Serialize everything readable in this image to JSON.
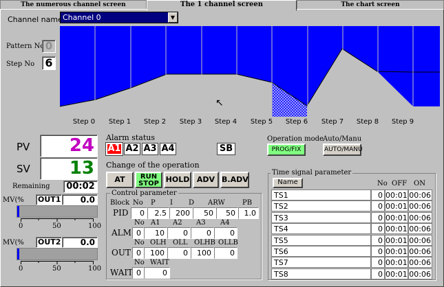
{
  "tabs": [
    {
      "label": "The numerous channel screen"
    },
    {
      "label": "The 1 channel screen"
    },
    {
      "label": "The chart screen"
    }
  ],
  "channel": {
    "label": "Channel name",
    "value": "Channel 0"
  },
  "pattern": {
    "label": "Pattern No",
    "value": "0"
  },
  "step": {
    "label": "Step No",
    "value": "6"
  },
  "steps": [
    "Step 0",
    "Step 1",
    "Step 2",
    "Step 3",
    "Step 4",
    "Step 5",
    "Step 6",
    "Step 7",
    "Step 8",
    "Step 9"
  ],
  "pv": {
    "label": "PV",
    "value": "24",
    "color": "#c000c0"
  },
  "sv": {
    "label": "SV",
    "value": "13",
    "color": "#008000"
  },
  "remaining": {
    "label": "Remaining",
    "value": "00:02"
  },
  "mv1": {
    "label": "MV(%",
    "name": "OUT1",
    "value": "0.0",
    "fraction": 0.0,
    "ticks": [
      "0",
      "50",
      "100"
    ]
  },
  "mv2": {
    "label": "MV(%",
    "name": "OUT2",
    "value": "0.0",
    "fraction": 0.0,
    "ticks": [
      "0",
      "50",
      "100"
    ]
  },
  "alarm": {
    "title": "Alarm status",
    "items": [
      "A1",
      "A2",
      "A3",
      "A4"
    ],
    "active_color": "#ff0000",
    "sb": "SB"
  },
  "operation_mode": {
    "title": "Operation mode",
    "button": "PROG/FIX",
    "color": "#80ff80"
  },
  "auto_manu": {
    "title": "Auto/Manu",
    "button": "AUTO/MANU"
  },
  "change": {
    "title": "Change of the operation",
    "buttons": [
      "AT",
      "RUN STOP",
      "HOLD",
      "ADV",
      "B.ADV"
    ]
  },
  "control": {
    "title": "Control parameter",
    "block_label": "Block",
    "pid": {
      "label": "PID",
      "headers": [
        "No",
        "P",
        "I",
        "D",
        "ARW",
        "PB"
      ],
      "values": [
        "0",
        "2.5",
        "200",
        "50",
        "50",
        "1.0"
      ]
    },
    "alm": {
      "label": "ALM",
      "headers": [
        "No",
        "A1",
        "A2",
        "A3",
        "A4"
      ],
      "values": [
        "0",
        "10",
        "0",
        "0",
        "0"
      ]
    },
    "out": {
      "label": "OUT",
      "headers": [
        "No",
        "OLH",
        "OLL",
        "OLHB",
        "OLLB"
      ],
      "values": [
        "0",
        "100",
        "0",
        "100",
        "0"
      ]
    },
    "wait": {
      "label": "WAIT",
      "headers": [
        "No",
        "WAIT"
      ],
      "values": [
        "0",
        "0"
      ]
    }
  },
  "time_signal": {
    "title": "Time signal parameter",
    "headers": {
      "name": "Name",
      "no": "No",
      "off": "OFF",
      "on": "ON"
    },
    "rows": [
      {
        "name": "TS1",
        "no": "0",
        "off": "00:01",
        "on": "00:06"
      },
      {
        "name": "TS2",
        "no": "0",
        "off": "00:01",
        "on": "00:06"
      },
      {
        "name": "TS3",
        "no": "0",
        "off": "00:01",
        "on": "00:06"
      },
      {
        "name": "TS4",
        "no": "0",
        "off": "00:01",
        "on": "00:06"
      },
      {
        "name": "TS5",
        "no": "0",
        "off": "00:01",
        "on": "00:06"
      },
      {
        "name": "TS6",
        "no": "0",
        "off": "00:01",
        "on": "00:06"
      },
      {
        "name": "TS7",
        "no": "0",
        "off": "00:01",
        "on": "00:06"
      },
      {
        "name": "TS8",
        "no": "0",
        "off": "00:01",
        "on": "00:06"
      }
    ]
  },
  "chart_data": {
    "type": "area",
    "categories": [
      "Step 0",
      "Step 1",
      "Step 2",
      "Step 3",
      "Step 4",
      "Step 5",
      "Step 6",
      "Step 7",
      "Step 8",
      "Step 9"
    ],
    "profile_top": [
      1.0,
      1.0,
      1.0,
      1.0,
      1.0,
      1.0,
      1.0,
      1.0,
      1.0,
      1.0
    ],
    "profile_lower_start": [
      0.12,
      0.18,
      0.3,
      0.3,
      0.3,
      0.3,
      0.35,
      0.0,
      0.78,
      0.55
    ],
    "fill_color": "#0000ff",
    "current_step": 6
  }
}
